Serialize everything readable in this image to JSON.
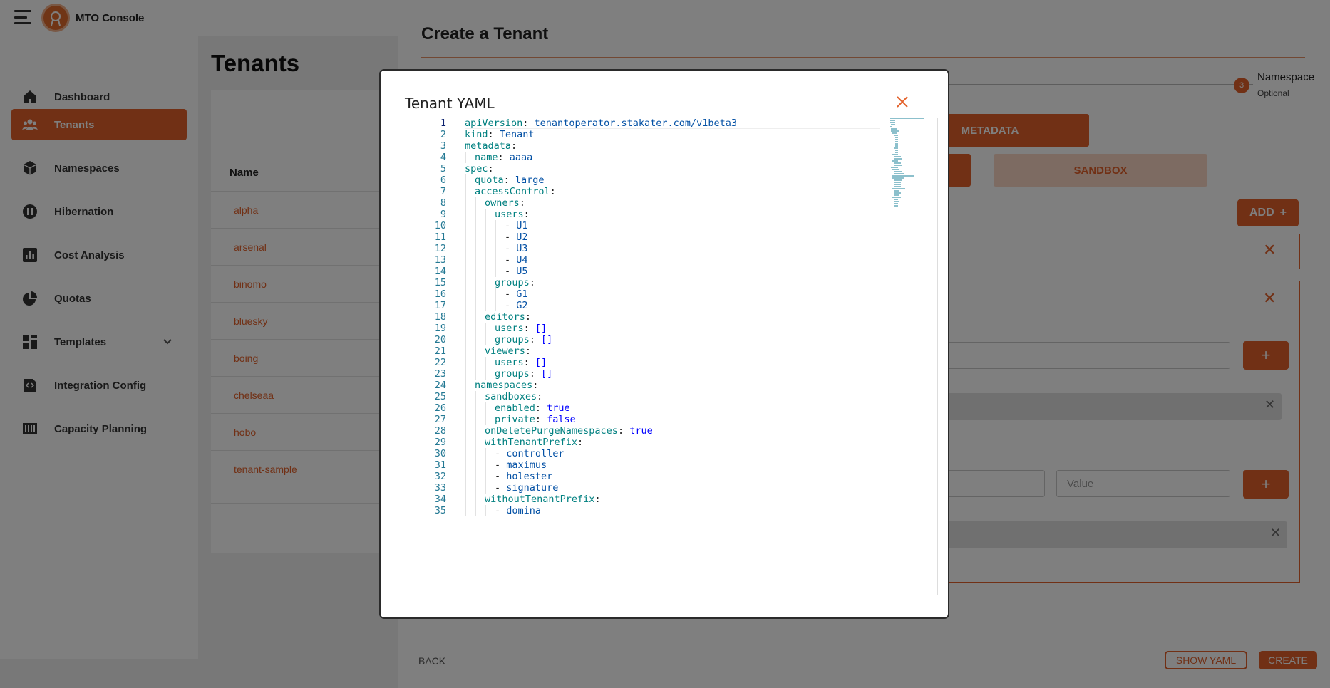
{
  "app": {
    "brand": "MTO Console"
  },
  "sidebar": {
    "items": [
      {
        "label": "Dashboard",
        "icon": "home-icon"
      },
      {
        "label": "Tenants",
        "icon": "users-icon"
      },
      {
        "label": "Namespaces",
        "icon": "cube-icon"
      },
      {
        "label": "Hibernation",
        "icon": "pause-icon"
      },
      {
        "label": "Cost Analysis",
        "icon": "bar-chart-icon"
      },
      {
        "label": "Quotas",
        "icon": "pie-chart-icon"
      },
      {
        "label": "Templates",
        "icon": "grid-icon"
      },
      {
        "label": "Integration Config",
        "icon": "code-icon"
      },
      {
        "label": "Capacity Planning",
        "icon": "capacity-icon"
      }
    ],
    "active": "Tenants"
  },
  "main": {
    "title": "Tenants",
    "table": {
      "header": "Name",
      "rows": [
        "alpha",
        "arsenal",
        "binomo",
        "bluesky",
        "boing",
        "chelseaa",
        "hobo",
        "tenant-sample"
      ]
    }
  },
  "drawer": {
    "title": "Create a Tenant",
    "step": {
      "number": "3",
      "label": "Namespace",
      "sub": "Optional"
    },
    "tabs": {
      "metadata": "METADATA",
      "sandbox": "SANDBOX"
    },
    "add_label": "ADD",
    "value_placeholder": "Value",
    "back_label": "BACK",
    "show_yaml_label": "SHOW YAML",
    "create_label": "CREATE"
  },
  "modal": {
    "title": "Tenant YAML",
    "yaml_lines": [
      {
        "indent": 0,
        "parts": [
          [
            "k",
            "apiVersion"
          ],
          [
            "p",
            ": "
          ],
          [
            "s",
            "tenantoperator.stakater.com/v1beta3"
          ]
        ]
      },
      {
        "indent": 0,
        "parts": [
          [
            "k",
            "kind"
          ],
          [
            "p",
            ": "
          ],
          [
            "s",
            "Tenant"
          ]
        ]
      },
      {
        "indent": 0,
        "parts": [
          [
            "k",
            "metadata"
          ],
          [
            "p",
            ":"
          ]
        ]
      },
      {
        "indent": 1,
        "parts": [
          [
            "k",
            "name"
          ],
          [
            "p",
            ": "
          ],
          [
            "s",
            "aaaa"
          ]
        ]
      },
      {
        "indent": 0,
        "parts": [
          [
            "k",
            "spec"
          ],
          [
            "p",
            ":"
          ]
        ]
      },
      {
        "indent": 1,
        "parts": [
          [
            "k",
            "quota"
          ],
          [
            "p",
            ": "
          ],
          [
            "s",
            "large"
          ]
        ]
      },
      {
        "indent": 1,
        "parts": [
          [
            "k",
            "accessControl"
          ],
          [
            "p",
            ":"
          ]
        ]
      },
      {
        "indent": 2,
        "parts": [
          [
            "k",
            "owners"
          ],
          [
            "p",
            ":"
          ]
        ]
      },
      {
        "indent": 3,
        "parts": [
          [
            "k",
            "users"
          ],
          [
            "p",
            ":"
          ]
        ]
      },
      {
        "indent": 4,
        "parts": [
          [
            "p",
            "- "
          ],
          [
            "s",
            "U1"
          ]
        ]
      },
      {
        "indent": 4,
        "parts": [
          [
            "p",
            "- "
          ],
          [
            "s",
            "U2"
          ]
        ]
      },
      {
        "indent": 4,
        "parts": [
          [
            "p",
            "- "
          ],
          [
            "s",
            "U3"
          ]
        ]
      },
      {
        "indent": 4,
        "parts": [
          [
            "p",
            "- "
          ],
          [
            "s",
            "U4"
          ]
        ]
      },
      {
        "indent": 4,
        "parts": [
          [
            "p",
            "- "
          ],
          [
            "s",
            "U5"
          ]
        ]
      },
      {
        "indent": 3,
        "parts": [
          [
            "k",
            "groups"
          ],
          [
            "p",
            ":"
          ]
        ]
      },
      {
        "indent": 4,
        "parts": [
          [
            "p",
            "- "
          ],
          [
            "s",
            "G1"
          ]
        ]
      },
      {
        "indent": 4,
        "parts": [
          [
            "p",
            "- "
          ],
          [
            "s",
            "G2"
          ]
        ]
      },
      {
        "indent": 2,
        "parts": [
          [
            "k",
            "editors"
          ],
          [
            "p",
            ":"
          ]
        ]
      },
      {
        "indent": 3,
        "parts": [
          [
            "k",
            "users"
          ],
          [
            "p",
            ": "
          ],
          [
            "b",
            "[]"
          ]
        ]
      },
      {
        "indent": 3,
        "parts": [
          [
            "k",
            "groups"
          ],
          [
            "p",
            ": "
          ],
          [
            "b",
            "[]"
          ]
        ]
      },
      {
        "indent": 2,
        "parts": [
          [
            "k",
            "viewers"
          ],
          [
            "p",
            ":"
          ]
        ]
      },
      {
        "indent": 3,
        "parts": [
          [
            "k",
            "users"
          ],
          [
            "p",
            ": "
          ],
          [
            "b",
            "[]"
          ]
        ]
      },
      {
        "indent": 3,
        "parts": [
          [
            "k",
            "groups"
          ],
          [
            "p",
            ": "
          ],
          [
            "b",
            "[]"
          ]
        ]
      },
      {
        "indent": 1,
        "parts": [
          [
            "k",
            "namespaces"
          ],
          [
            "p",
            ":"
          ]
        ]
      },
      {
        "indent": 2,
        "parts": [
          [
            "k",
            "sandboxes"
          ],
          [
            "p",
            ":"
          ]
        ]
      },
      {
        "indent": 3,
        "parts": [
          [
            "k",
            "enabled"
          ],
          [
            "p",
            ": "
          ],
          [
            "b",
            "true"
          ]
        ]
      },
      {
        "indent": 3,
        "parts": [
          [
            "k",
            "private"
          ],
          [
            "p",
            ": "
          ],
          [
            "b",
            "false"
          ]
        ]
      },
      {
        "indent": 2,
        "parts": [
          [
            "k",
            "onDeletePurgeNamespaces"
          ],
          [
            "p",
            ": "
          ],
          [
            "b",
            "true"
          ]
        ]
      },
      {
        "indent": 2,
        "parts": [
          [
            "k",
            "withTenantPrefix"
          ],
          [
            "p",
            ":"
          ]
        ]
      },
      {
        "indent": 3,
        "parts": [
          [
            "p",
            "- "
          ],
          [
            "s",
            "controller"
          ]
        ]
      },
      {
        "indent": 3,
        "parts": [
          [
            "p",
            "- "
          ],
          [
            "s",
            "maximus"
          ]
        ]
      },
      {
        "indent": 3,
        "parts": [
          [
            "p",
            "- "
          ],
          [
            "s",
            "holester"
          ]
        ]
      },
      {
        "indent": 3,
        "parts": [
          [
            "p",
            "- "
          ],
          [
            "s",
            "signature"
          ]
        ]
      },
      {
        "indent": 2,
        "parts": [
          [
            "k",
            "withoutTenantPrefix"
          ],
          [
            "p",
            ":"
          ]
        ]
      },
      {
        "indent": 3,
        "parts": [
          [
            "p",
            "- "
          ],
          [
            "s",
            "domina"
          ]
        ]
      }
    ]
  },
  "colors": {
    "accent": "#e3612a",
    "key": "#008080",
    "string": "#0451a5",
    "boolean": "#0000ff",
    "line_number": "#237893"
  }
}
